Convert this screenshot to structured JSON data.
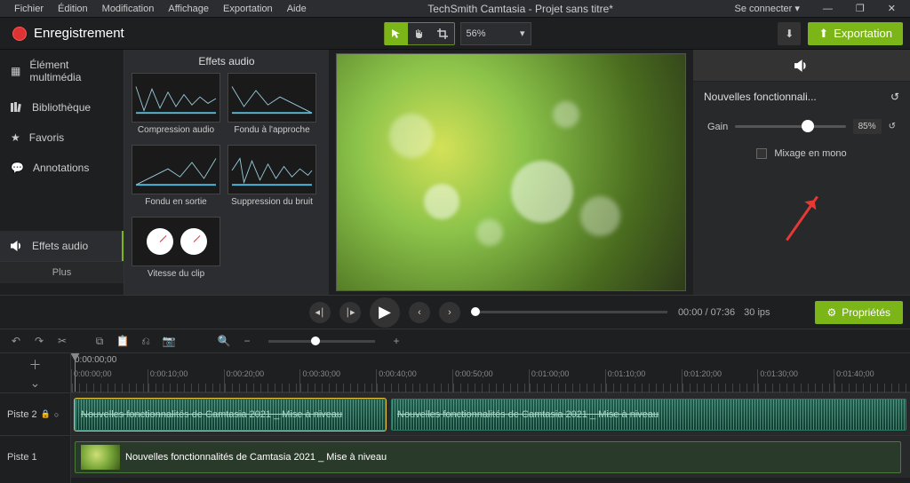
{
  "menu": {
    "items": [
      "Fichier",
      "Édition",
      "Modification",
      "Affichage",
      "Exportation",
      "Aide"
    ],
    "title": "TechSmith Camtasia - Projet sans titre*",
    "signin": "Se connecter"
  },
  "toolbar": {
    "record": "Enregistrement",
    "zoom": "56%",
    "export": "Exportation"
  },
  "sidebar": {
    "items": [
      {
        "label": "Élément multimédia"
      },
      {
        "label": "Bibliothèque"
      },
      {
        "label": "Favoris"
      },
      {
        "label": "Annotations"
      },
      {
        "label": "Effets audio"
      }
    ],
    "more": "Plus"
  },
  "mediaPanel": {
    "header": "Effets audio",
    "thumbs": [
      "Compression audio",
      "Fondu à l'approche",
      "Fondu en sortie",
      "Suppression du bruit",
      "Vitesse du clip"
    ]
  },
  "props": {
    "section": "Nouvelles fonctionnali...",
    "gainLabel": "Gain",
    "gainValue": "85%",
    "mixLabel": "Mixage en mono"
  },
  "transport": {
    "time": "00:00 / 07:36",
    "fps": "30 ips",
    "propsBtn": "Propriétés"
  },
  "timeline": {
    "playhead": "0:00:00;00",
    "ticks": [
      "0:00:00;00",
      "0:00:10;00",
      "0:00:20;00",
      "0:00:30;00",
      "0:00:40;00",
      "0:00:50;00",
      "0:01:00;00",
      "0:01:10;00",
      "0:01:20;00",
      "0:01:30;00",
      "0:01:40;00"
    ],
    "track2": "Piste 2",
    "track1": "Piste 1",
    "clip2a": "Nouvelles fonctionnalités de Camtasia 2021 _ Mise à niveau",
    "clip2b": "Nouvelles fonctionnalités de Camtasia 2021 _ Mise à niveau",
    "clip1": "Nouvelles fonctionnalités de Camtasia 2021 _ Mise à niveau"
  }
}
